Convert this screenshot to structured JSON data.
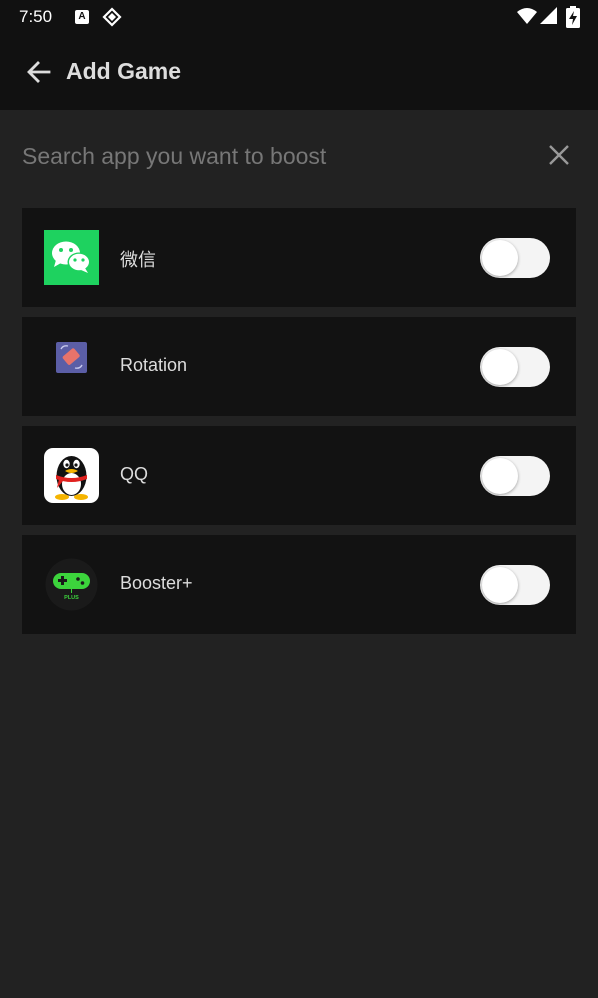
{
  "status_bar": {
    "time": "7:50",
    "badge_letter": "A"
  },
  "app_bar": {
    "title": "Add Game",
    "back_icon": "arrow-left-icon"
  },
  "search": {
    "placeholder": "Search app you want to boost",
    "value": "",
    "clear_icon": "close-icon"
  },
  "apps": [
    {
      "name": "微信",
      "icon": "wechat-icon",
      "enabled": false
    },
    {
      "name": "Rotation",
      "icon": "rotation-icon",
      "enabled": false
    },
    {
      "name": "QQ",
      "icon": "qq-icon",
      "enabled": false
    },
    {
      "name": "Booster+",
      "icon": "booster-plus-icon",
      "enabled": false
    }
  ],
  "icon_labels": {
    "booster_plus_text": "PLUS"
  },
  "colors": {
    "background": "#222222",
    "bar": "#111111",
    "row": "#121212",
    "text": "#dddddd",
    "placeholder": "#777777",
    "wechat_green": "#1ed25f",
    "rotation_purple": "#5b5ea6",
    "booster_green": "#3cd43c"
  }
}
